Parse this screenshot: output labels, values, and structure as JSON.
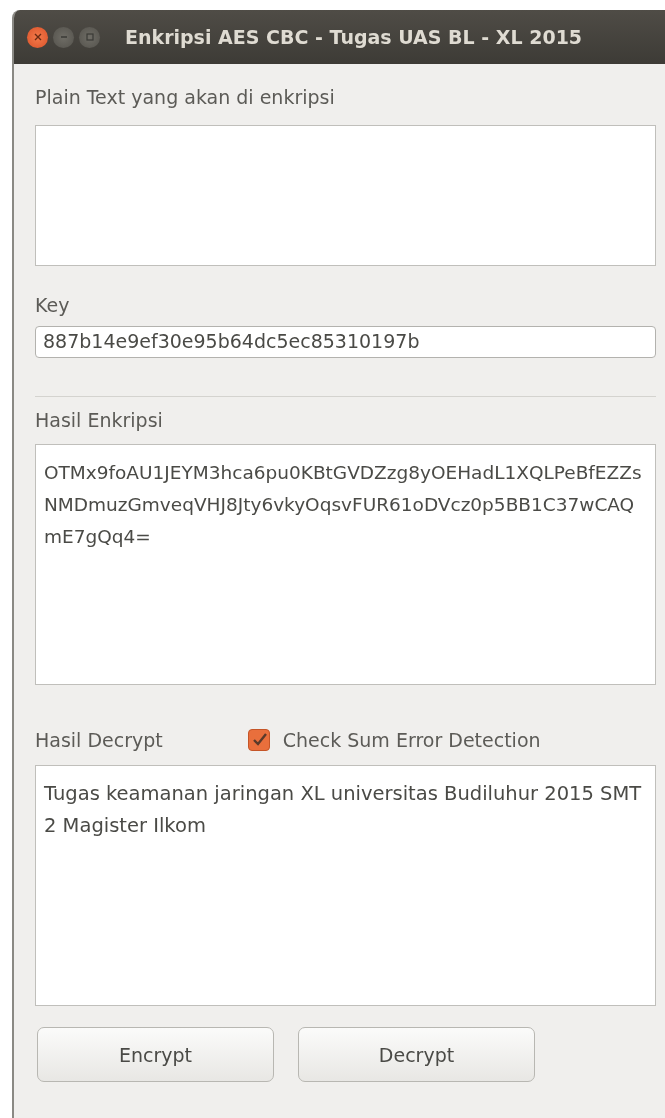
{
  "window": {
    "title": "Enkripsi AES CBC - Tugas UAS BL - XL 2015"
  },
  "plain_text": {
    "label": "Plain Text yang akan di enkripsi"
  },
  "key": {
    "label": "Key",
    "value": "887b14e9ef30e95b64dc5ec85310197b"
  },
  "encrypted": {
    "label": "Hasil Enkripsi",
    "value": "OTMx9foAU1JEYM3hca6pu0KBtGVDZzg8yOEHadL1XQLPeBfEZZsNMDmuzGmveqVHJ8Jty6vkyOqsvFUR61oDVcz0p5BB1C37wCAQmE7gQq4="
  },
  "decrypted": {
    "label": "Hasil Decrypt",
    "value": "Tugas keamanan jaringan XL universitas Budiluhur 2015 SMT 2 Magister Ilkom"
  },
  "checksum": {
    "label": "Check Sum Error Detection",
    "checked": true
  },
  "buttons": [
    {
      "label": "Encrypt"
    },
    {
      "label": "Decrypt"
    }
  ]
}
